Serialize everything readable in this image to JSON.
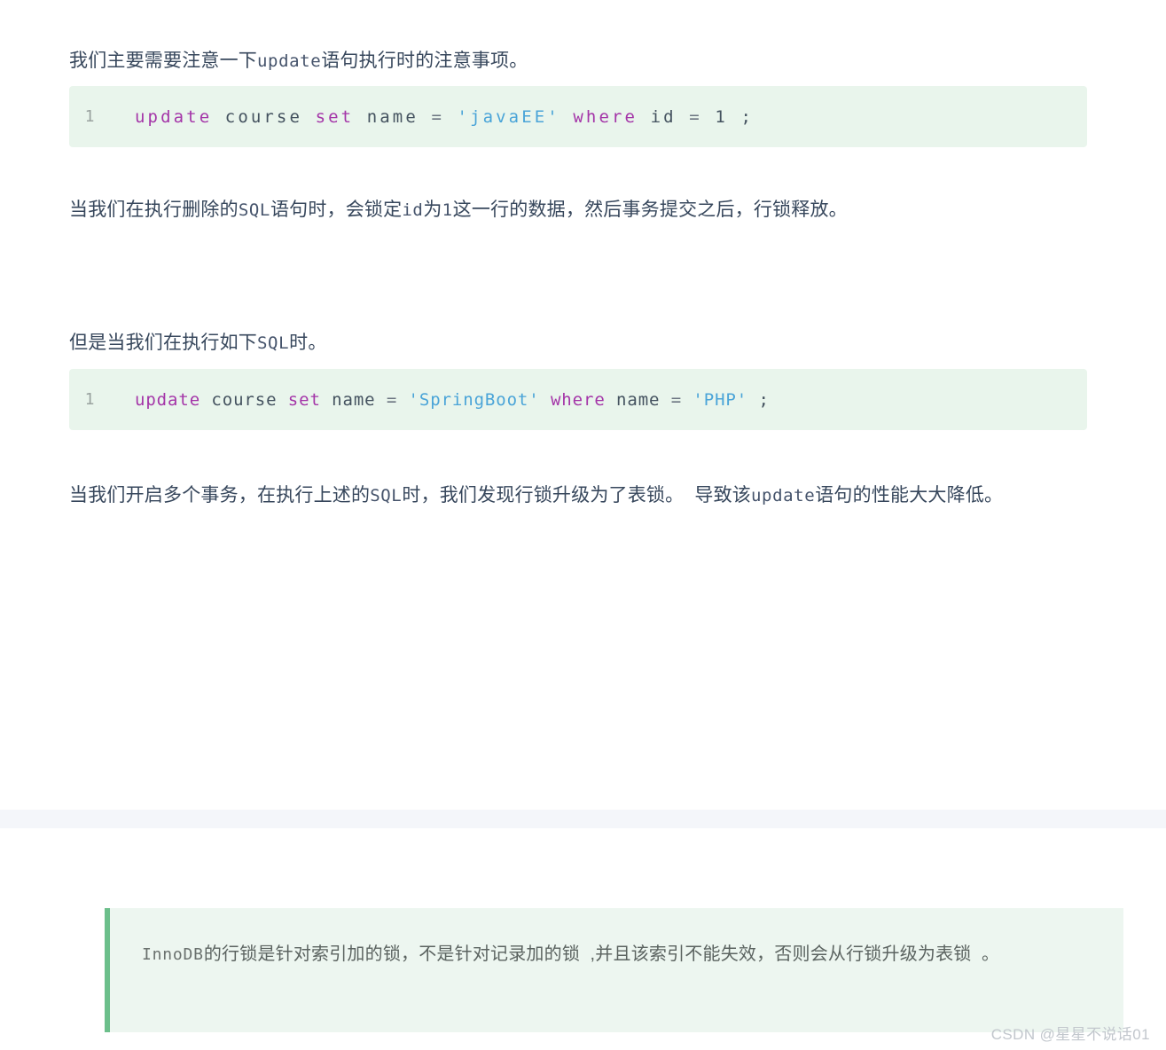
{
  "article": {
    "paragraphs": [
      {
        "id": "para-1",
        "segments": [
          {
            "type": "text",
            "value": "我们主要需要注意一下"
          },
          {
            "type": "mono",
            "value": "update"
          },
          {
            "type": "text",
            "value": "语句执行时的注意事项。"
          }
        ]
      },
      {
        "id": "para-2",
        "segments": [
          {
            "type": "text",
            "value": "当我们在执行删除的"
          },
          {
            "type": "mono",
            "value": "SQL"
          },
          {
            "type": "text",
            "value": "语句时，会锁定"
          },
          {
            "type": "mono",
            "value": "id"
          },
          {
            "type": "text",
            "value": "为"
          },
          {
            "type": "mono",
            "value": "1"
          },
          {
            "type": "text",
            "value": "这一行的数据，然后事务提交之后，行锁释放。"
          }
        ]
      },
      {
        "id": "para-3",
        "segments": [
          {
            "type": "text",
            "value": "但是当我们在执行如下"
          },
          {
            "type": "mono",
            "value": "SQL"
          },
          {
            "type": "text",
            "value": "时。"
          }
        ]
      },
      {
        "id": "para-4",
        "segments": [
          {
            "type": "text",
            "value": "当我们开启多个事务，在执行上述的"
          },
          {
            "type": "mono",
            "value": "SQL"
          },
          {
            "type": "text",
            "value": "时，我们发现行锁升级为了表锁。  导致该"
          },
          {
            "type": "mono",
            "value": "update"
          },
          {
            "type": "text",
            "value": "语句的性能大大降低。"
          }
        ]
      }
    ],
    "code_blocks": [
      {
        "id": "code-1",
        "line_number": "1",
        "plain": "update  course  set  name =  'javaEE'  where  id  =  1 ;",
        "tokens": [
          {
            "type": "kw",
            "value": "update"
          },
          {
            "type": "id",
            "value": "course"
          },
          {
            "type": "kw",
            "value": "set"
          },
          {
            "type": "id",
            "value": "name"
          },
          {
            "type": "op",
            "value": "="
          },
          {
            "type": "str",
            "value": "'javaEE'"
          },
          {
            "type": "kw",
            "value": "where"
          },
          {
            "type": "id",
            "value": "id"
          },
          {
            "type": "op",
            "value": "="
          },
          {
            "type": "num",
            "value": "1"
          },
          {
            "type": "punc",
            "value": ";"
          }
        ]
      },
      {
        "id": "code-2",
        "line_number": "1",
        "plain": "update course set name = 'SpringBoot' where name = 'PHP' ;",
        "tokens": [
          {
            "type": "kw",
            "value": "update"
          },
          {
            "type": "id",
            "value": "course"
          },
          {
            "type": "kw",
            "value": "set"
          },
          {
            "type": "id",
            "value": "name"
          },
          {
            "type": "op",
            "value": "="
          },
          {
            "type": "str",
            "value": "'SpringBoot'"
          },
          {
            "type": "kw",
            "value": "where"
          },
          {
            "type": "id",
            "value": "name"
          },
          {
            "type": "op",
            "value": "="
          },
          {
            "type": "str",
            "value": "'PHP'"
          },
          {
            "type": "punc",
            "value": ";"
          }
        ]
      }
    ],
    "blockquote": {
      "segments": [
        {
          "type": "mono",
          "value": "InnoDB"
        },
        {
          "type": "text",
          "value": "的行锁是针对索引加的锁，不是针对记录加的锁  ,并且该索引不能失效，否则会从行锁升级为表锁  。"
        }
      ]
    },
    "watermark": "CSDN @星星不说话01"
  },
  "colors": {
    "page_background": "#ffffff",
    "body_text": "#37475c",
    "code_background": "#e9f5ec",
    "code_keyword": "#a435a8",
    "code_string": "#4aa4d8",
    "code_identifier": "#44525f",
    "code_line_number": "#9aa3a0",
    "divider_band": "#f4f6fa",
    "blockquote_background": "#edf6f0",
    "blockquote_border": "#6cbf8b",
    "blockquote_text": "#5b6360",
    "watermark_text": "#c2c7cd"
  }
}
